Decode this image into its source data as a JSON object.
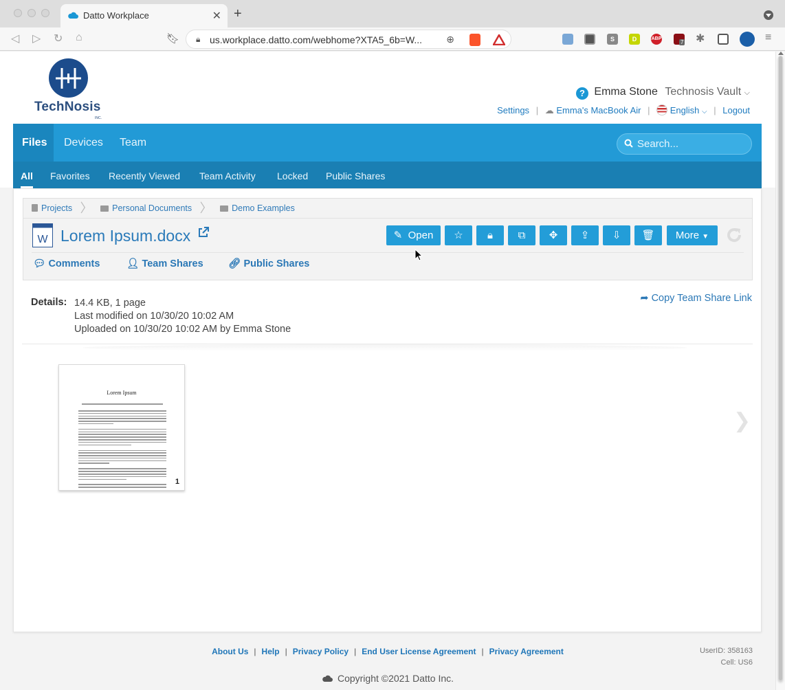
{
  "browser": {
    "tab_title": "Datto Workplace",
    "tab_close": "✕",
    "new_tab": "+",
    "url": "us.workplace.datto.com/webhome?XTA5_6b=W...",
    "extensions": [
      "ghost-extension",
      "notion-extension",
      "s-extension",
      "d-extension",
      "abp-extension",
      "ublock-extension",
      "puzzle-extension",
      "wallet-extension",
      "profile-extension"
    ],
    "ublock_badge": "7",
    "abp_label": "ABP",
    "s_label": "S",
    "d_label": "D"
  },
  "header": {
    "logo_text": "TechNosis",
    "logo_sub": "INC.",
    "user_name": "Emma Stone",
    "vault_name": "Technosis Vault",
    "links": {
      "settings": "Settings",
      "device": "Emma's MacBook Air",
      "language": "English",
      "logout": "Logout"
    }
  },
  "main_nav": {
    "items": [
      "Files",
      "Devices",
      "Team"
    ],
    "active": "Files",
    "search_placeholder": "Search..."
  },
  "sub_nav": {
    "items": [
      "All",
      "Favorites",
      "Recently Viewed",
      "Team Activity",
      "Locked",
      "Public Shares"
    ],
    "active": "All"
  },
  "breadcrumb": [
    "Projects",
    "Personal Documents",
    "Demo Examples"
  ],
  "file": {
    "name": "Lorem Ipsum.docx",
    "open_label": "Open",
    "more_label": "More",
    "tabs": [
      "Comments",
      "Team Shares",
      "Public Shares"
    ]
  },
  "details": {
    "label": "Details:",
    "size": "14.4 KB, 1 page",
    "modified": "Last modified on 10/30/20 10:02 AM",
    "uploaded": "Uploaded on 10/30/20 10:02 AM by Emma Stone",
    "copy_link": "Copy Team Share Link"
  },
  "preview": {
    "title": "Lorem Ipsum",
    "page_number": "1"
  },
  "footer": {
    "links": [
      "About Us",
      "Help",
      "Privacy Policy",
      "End User License Agreement",
      "Privacy Agreement"
    ],
    "user_id": "UserID: 358163",
    "cell": "Cell: US6",
    "copyright": "Copyright ©2021 Datto Inc."
  },
  "colors": {
    "brand_blue": "#229ad6",
    "subnav_blue": "#1a7fb3",
    "link_blue": "#2b78b6",
    "button_blue": "#239dd8"
  }
}
